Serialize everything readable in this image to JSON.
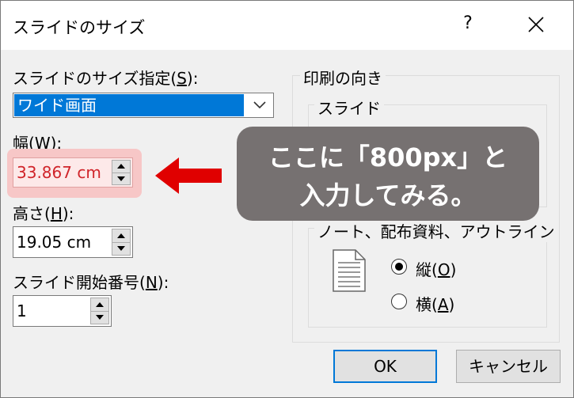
{
  "dialog": {
    "title": "スライドのサイズ",
    "help_glyph": "?"
  },
  "size_spec": {
    "label_pre": "スライドのサイズ指定(",
    "label_key": "S",
    "label_post": "):",
    "selected": "ワイド画面"
  },
  "width": {
    "label_pre": "幅(",
    "label_key": "W",
    "label_post": "):",
    "value": "33.867 cm"
  },
  "height": {
    "label_pre": "高さ(",
    "label_key": "H",
    "label_post": "):",
    "value": "19.05 cm"
  },
  "start_number": {
    "label_pre": "スライド開始番号(",
    "label_key": "N",
    "label_post": "):",
    "value": "1"
  },
  "orientation": {
    "group_label": "印刷の向き",
    "slides_label": "スライド",
    "notes_label": "ノート、配布資料、アウトライン",
    "portrait_pre": "縦(",
    "portrait_key": "O",
    "portrait_post": ")",
    "landscape_pre": "横(",
    "landscape_key": "A",
    "landscape_post": ")"
  },
  "buttons": {
    "ok": "OK",
    "cancel": "キャンセル"
  },
  "callout": {
    "line1": "ここに「800px」と",
    "line2": "入力してみる。"
  },
  "colors": {
    "accent": "#0078d7",
    "highlight": "#f7c7c7",
    "arrow": "#e00000",
    "callout_bg": "#767171"
  }
}
